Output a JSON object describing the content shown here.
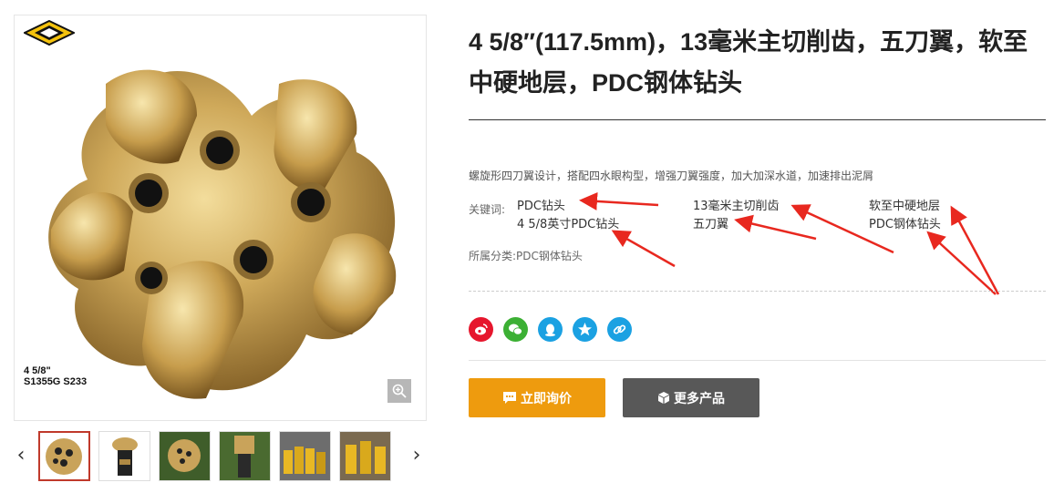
{
  "product": {
    "title": "4 5/8″(117.5mm)，13毫米主切削齿，五刀翼，软至中硬地层，PDC钢体钻头",
    "caption_line1": "4 5/8\"",
    "caption_line2": "S1355G S233",
    "description": "螺旋形四刀翼设计，搭配四水眼构型，增强刀翼强度，加大加深水道，加速排出泥屑",
    "keywords_label": "关键词:",
    "keywords": [
      "PDC钻头",
      "4 5/8英寸PDC钻头",
      "13毫米主切削齿",
      "五刀翼",
      "软至中硬地层",
      "PDC钢体钻头"
    ],
    "category": "所属分类:PDC钢体钻头"
  },
  "gallery": {
    "thumbs": [
      "thumb-1",
      "thumb-2",
      "thumb-3",
      "thumb-4",
      "thumb-5",
      "thumb-6"
    ],
    "prev_arrow": "‹",
    "next_arrow": "›"
  },
  "share": {
    "icons": [
      {
        "name": "weibo-icon",
        "color": "#e6162d"
      },
      {
        "name": "wechat-icon",
        "color": "#3cb034"
      },
      {
        "name": "qq-icon",
        "color": "#1ba1e2"
      },
      {
        "name": "qzone-icon",
        "color": "#1ba1e2"
      },
      {
        "name": "copy-link-icon",
        "color": "#1ba1e2"
      }
    ]
  },
  "actions": {
    "inquiry_label": "立即询价",
    "more_label": "更多产品"
  },
  "colors": {
    "accent_orange": "#ee9b0e",
    "button_gray": "#585858",
    "annotation_red": "#e8281f"
  }
}
